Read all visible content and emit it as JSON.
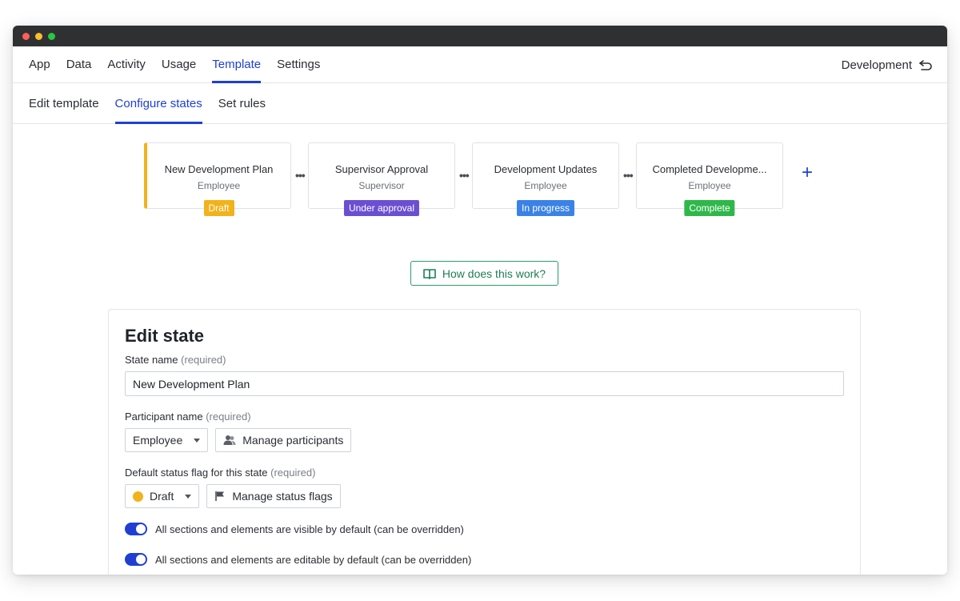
{
  "window": {
    "dots": [
      "#ff5f57",
      "#febc2e",
      "#28c840"
    ]
  },
  "topnav": {
    "items": [
      {
        "label": "App",
        "active": false
      },
      {
        "label": "Data",
        "active": false
      },
      {
        "label": "Activity",
        "active": false
      },
      {
        "label": "Usage",
        "active": false
      },
      {
        "label": "Template",
        "active": true
      },
      {
        "label": "Settings",
        "active": false
      }
    ],
    "environment": "Development"
  },
  "subnav": {
    "items": [
      {
        "label": "Edit template",
        "active": false
      },
      {
        "label": "Configure states",
        "active": true
      },
      {
        "label": "Set rules",
        "active": false
      }
    ]
  },
  "states": [
    {
      "title": "New Development Plan",
      "participant": "Employee",
      "badge": "Draft",
      "badge_color": "#f2b21b"
    },
    {
      "title": "Supervisor Approval",
      "participant": "Supervisor",
      "badge": "Under approval",
      "badge_color": "#6b4fd1"
    },
    {
      "title": "Development Updates",
      "participant": "Employee",
      "badge": "In progress",
      "badge_color": "#3b82e6"
    },
    {
      "title": "Completed Developme...",
      "participant": "Employee",
      "badge": "Complete",
      "badge_color": "#2fb84a"
    }
  ],
  "flow": {
    "ellipsis": "•••",
    "add": "+"
  },
  "help": {
    "label": "How does this work?"
  },
  "edit_state": {
    "heading": "Edit state",
    "state_name_label": "State name",
    "required": "(required)",
    "state_name_value": "New Development Plan",
    "participant_label": "Participant name",
    "participant_value": "Employee",
    "manage_participants": "Manage participants",
    "status_flag_label": "Default status flag for this state",
    "status_flag_value": "Draft",
    "status_flag_color": "#f2b21b",
    "manage_status_flags": "Manage status flags",
    "toggle_visible": "All sections and elements are visible by default (can be overridden)",
    "toggle_editable": "All sections and elements are editable by default (can be overridden)"
  }
}
